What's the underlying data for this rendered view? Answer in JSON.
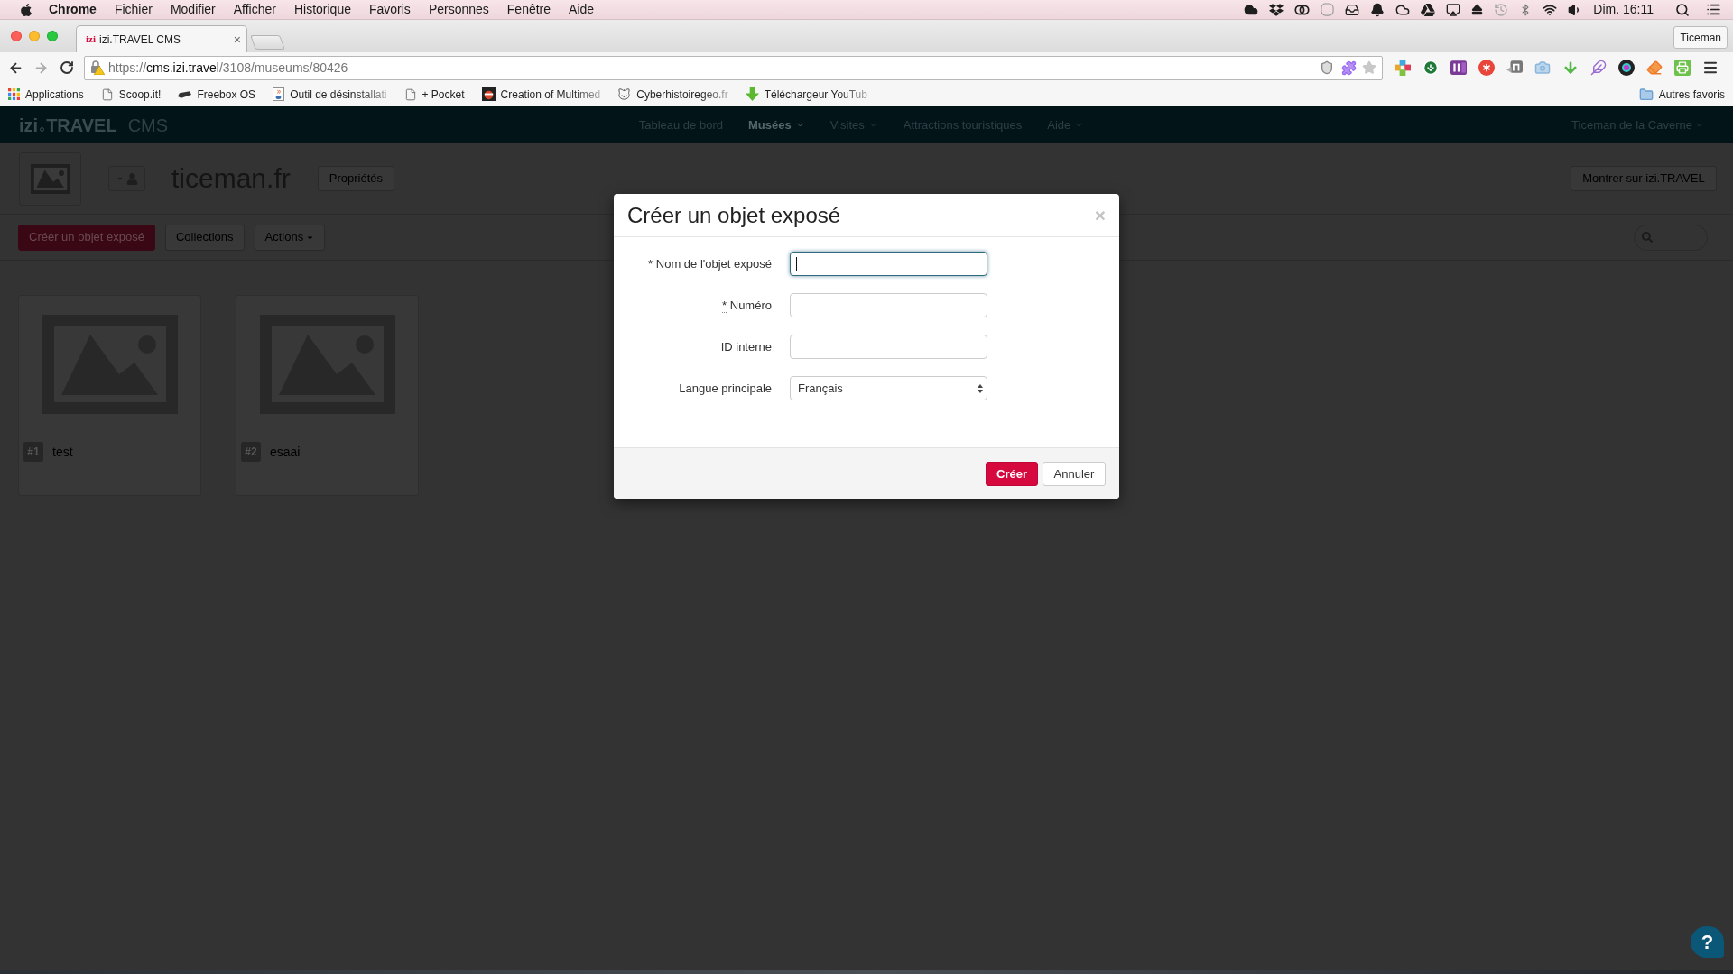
{
  "menu_bar": {
    "app": "Chrome",
    "items": [
      "Fichier",
      "Modifier",
      "Afficher",
      "Historique",
      "Favoris",
      "Personnes",
      "Fenêtre",
      "Aide"
    ],
    "clock": "Dim. 16:11"
  },
  "browser": {
    "tabs": [
      {
        "favicon": "izi",
        "title": "izi.TRAVEL CMS",
        "close": "×",
        "selected": true
      }
    ],
    "profile": "Ticeman",
    "address": {
      "scheme": "https://",
      "host": "cms.izi.travel",
      "path": "/3108/museums/80426"
    },
    "bookmarks": [
      {
        "label": "Applications",
        "kind": "apps",
        "truncated": false
      },
      {
        "label": "Scoop.it!",
        "kind": "page",
        "truncated": false
      },
      {
        "label": "Freebox OS",
        "kind": "device",
        "truncated": false
      },
      {
        "label": "Outil de désinstallati",
        "kind": "java",
        "truncated": true
      },
      {
        "label": "+ Pocket",
        "kind": "page",
        "truncated": false
      },
      {
        "label": "Creation of Multimed",
        "kind": "picture",
        "truncated": true
      },
      {
        "label": "Cyberhistoiregeo.fr",
        "kind": "cat",
        "truncated": true
      },
      {
        "label": "Téléchargeur YouTub",
        "kind": "download",
        "truncated": true
      }
    ],
    "other_bookmarks": "Autres favoris"
  },
  "app_nav": {
    "logo": {
      "brand": "izi",
      "name": "TRAVEL",
      "suffix": "CMS"
    },
    "items": [
      {
        "label": "Tableau de bord",
        "selected": false,
        "dropdown": false
      },
      {
        "label": "Musées",
        "selected": true,
        "dropdown": true
      },
      {
        "label": "Visites",
        "selected": false,
        "dropdown": true
      },
      {
        "label": "Attractions touristiques",
        "selected": false,
        "dropdown": false
      },
      {
        "label": "Aide",
        "selected": false,
        "dropdown": true
      }
    ],
    "user": {
      "name": "Ticeman de la Caverne",
      "dropdown": true
    }
  },
  "museum_header": {
    "title": "ticeman.fr",
    "properties_button": "Propriétés",
    "show_button": "Montrer sur izi.TRAVEL"
  },
  "toolbar": {
    "buttons": [
      {
        "label": "Créer un objet exposé",
        "kind": "primary",
        "dropdown": false
      },
      {
        "label": "Collections",
        "kind": "default",
        "dropdown": false
      },
      {
        "label": "Actions",
        "kind": "default",
        "dropdown": true
      }
    ]
  },
  "exhibits": [
    {
      "number": "#1",
      "title": "test"
    },
    {
      "number": "#2",
      "title": "esaai"
    }
  ],
  "modal": {
    "title": "Créer un objet exposé",
    "close": "×",
    "fields": [
      {
        "label": "Nom de l'objet exposé",
        "required_mark": "*",
        "kind": "text",
        "focused": true
      },
      {
        "label": "Numéro",
        "required_mark": "*",
        "kind": "text",
        "focused": false
      },
      {
        "label": "ID interne",
        "kind": "text",
        "focused": false
      },
      {
        "label": "Langue principale",
        "kind": "select",
        "value": "Français",
        "focused": false
      }
    ],
    "buttons": [
      {
        "label": "Créer",
        "kind": "primary"
      },
      {
        "label": "Annuler",
        "kind": "default"
      }
    ]
  },
  "help_button": {
    "label": "?"
  }
}
